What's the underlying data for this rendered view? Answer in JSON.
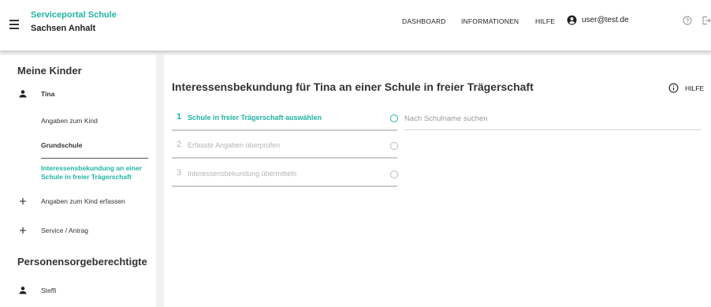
{
  "header": {
    "brand_line1": "Serviceportal Schule",
    "brand_line2": "Sachsen Anhalt",
    "nav": {
      "dashboard": "DASHBOARD",
      "informationen": "INFORMATIONEN",
      "hilfe": "HILFE"
    },
    "user_email": "user@test.de",
    "icons": [
      "menu-icon",
      "account-circle-icon",
      "help-circle-icon",
      "logout-icon"
    ]
  },
  "sidebar": {
    "children_heading": "Meine Kinder",
    "child_name": "Tina",
    "child_items": [
      "Angaben zum Kind",
      "Grundschule"
    ],
    "active_item": "Interessensbekundung an einer Schule in freier Trägerschaft",
    "add_child": "Angaben zum Kind erfassen",
    "service": "Service / Antrag",
    "guardians_heading": "Personensorgeberechtigte",
    "guardian_name": "Steffi"
  },
  "main": {
    "title": "Interessensbekundung für Tina an einer Schule in freier Trägerschaft",
    "help_label": "HILFE",
    "steps": [
      {
        "number": "1",
        "label": "Schule in freier Trägerschaft auswählen",
        "state": "active"
      },
      {
        "number": "2",
        "label": "Erfasste Angaben überprüfen",
        "state": "inactive"
      },
      {
        "number": "3",
        "label": "Interessensbekundung übermitteln",
        "state": "inactive"
      }
    ],
    "search_placeholder": "Nach Schulname suchen",
    "search_value": ""
  },
  "colors": {
    "accent": "#1fb5a3",
    "inactive": "#b5b5b5",
    "background": "#f1f1f1"
  }
}
